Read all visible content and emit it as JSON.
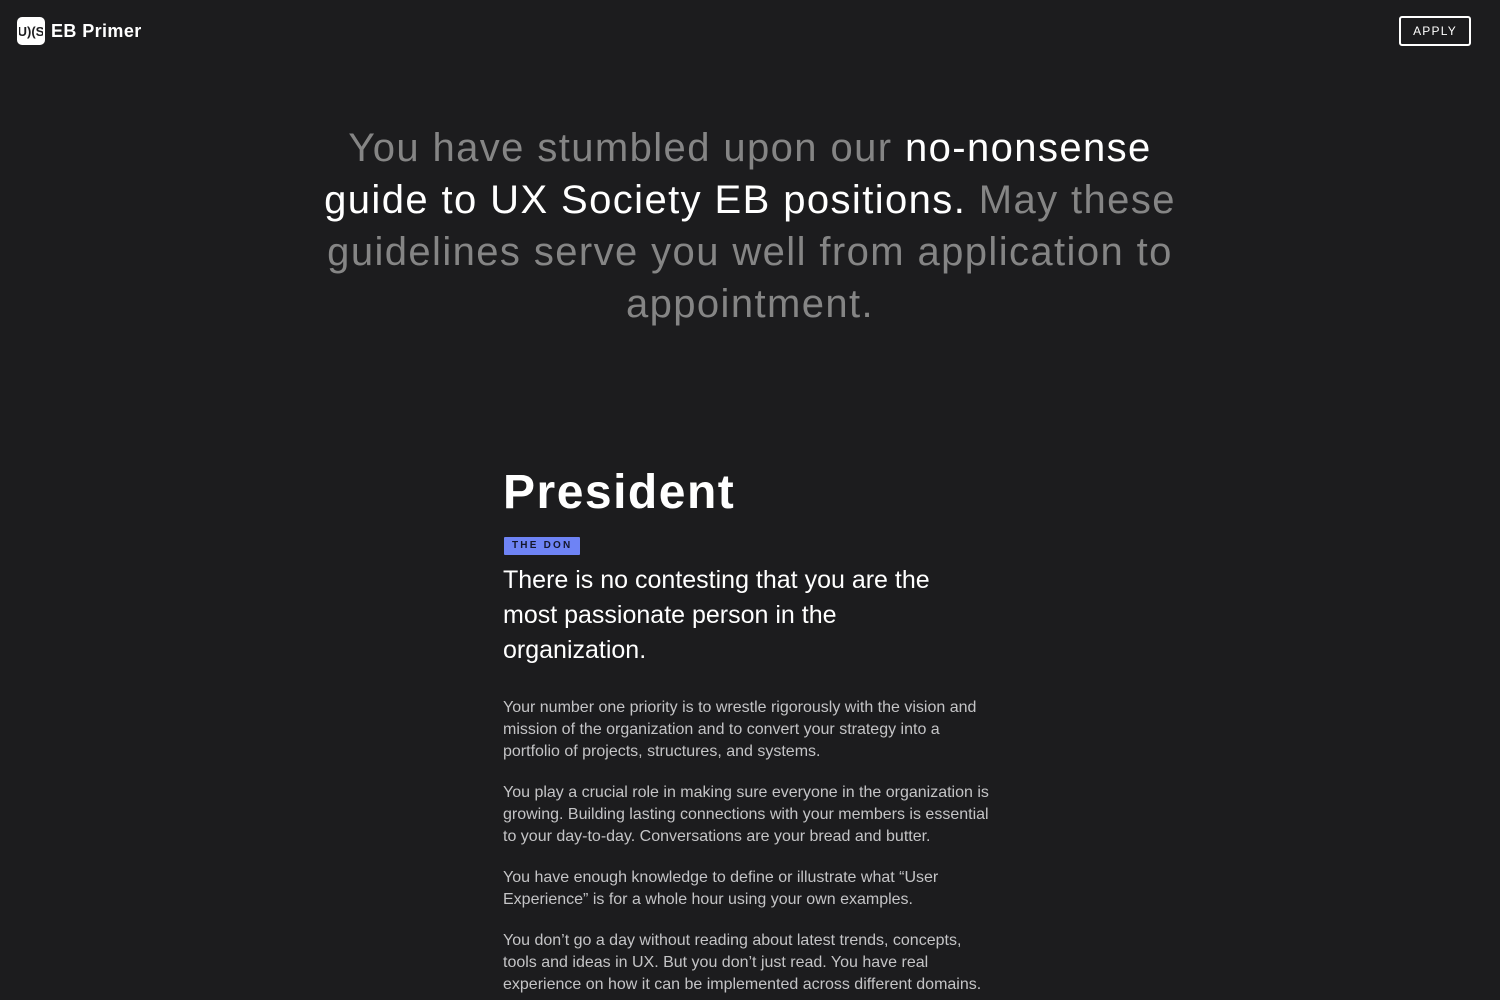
{
  "header": {
    "logo_text": "EB Primer",
    "logo_icon": "ux-society-logo-icon",
    "apply_label": "APPLY"
  },
  "hero": {
    "part1": "You have stumbled upon our ",
    "part2": "no-nonsense guide to UX Society EB positions.",
    "part3": " May these guidelines serve you well from application to appointment."
  },
  "role": {
    "title": "President",
    "badge": "THE DON",
    "lead": "There is no contesting that you are the most passionate person in the organization.",
    "paragraphs": [
      "Your number one priority is to wrestle rigorously with the vision and mission of the organization and to convert your strategy into a portfolio of projects, structures, and systems.",
      "You play a crucial role in making sure everyone in the organization is growing. Building lasting connections with your members is essential to your day-to-day. Conversations are your bread and butter.",
      "You have enough knowledge to define or illustrate what “User Experience” is for a whole hour using your own examples.",
      "You don’t go a day without reading about latest trends, concepts, tools and ideas in UX. But you don’t just read. You have real experience on how it can be implemented across different domains."
    ]
  },
  "colors": {
    "background": "#1c1c1e",
    "hero_dim_text": "#858585",
    "badge_background": "#6e83f5",
    "body_text": "#c4c4c6"
  }
}
